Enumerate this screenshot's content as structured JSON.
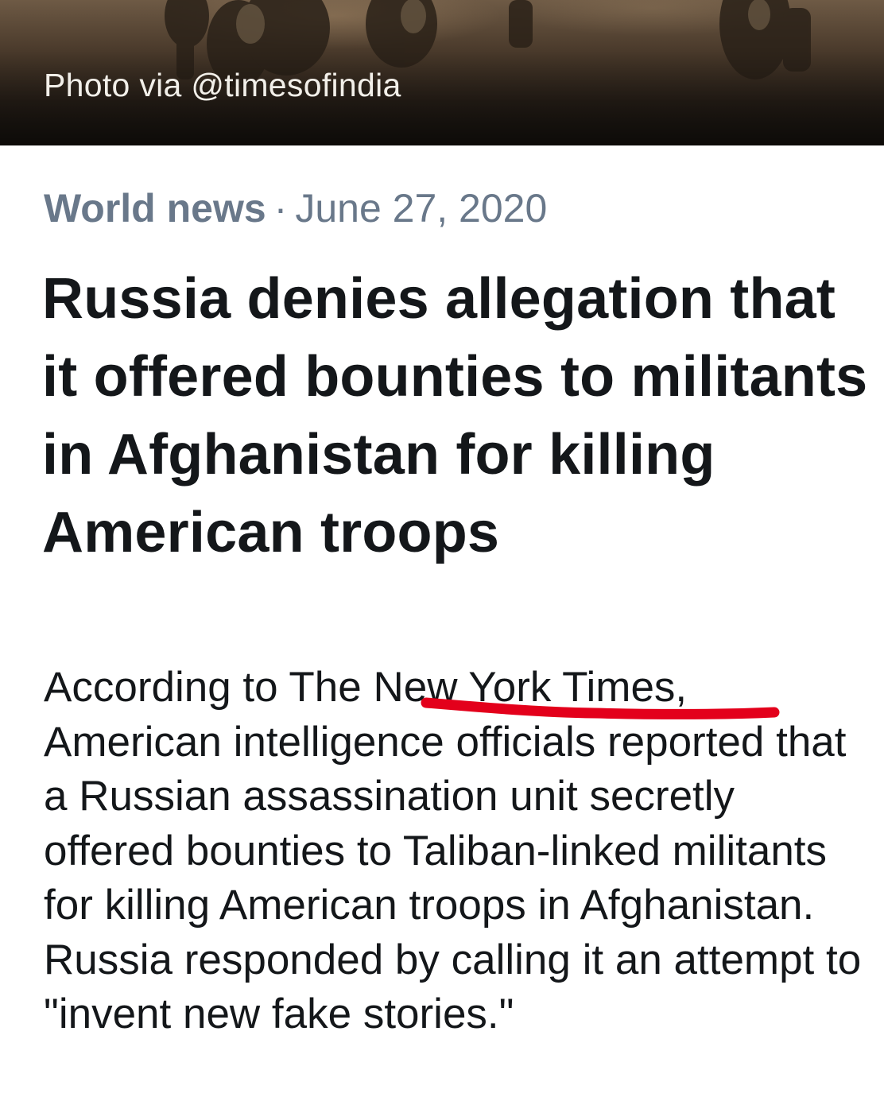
{
  "photo": {
    "credit": "Photo via @timesofindia"
  },
  "article": {
    "category": "World news",
    "separator": "·",
    "date": "June 27, 2020",
    "headline": "Russia denies allegation that it offered bounties to militants in Afghanistan for killing American troops",
    "summary_before": "According to The ",
    "summary_highlight": "New York Times",
    "summary_after": ", American intelligence officials reported that a Russian assassination unit secretly offered bounties to Taliban-linked militants for killing American troops in Afghanistan. Russia responded by calling it an attempt to \"invent new fake stories.\""
  },
  "colors": {
    "meta_text": "#69788a",
    "body_text": "#14171a",
    "annotation_red": "#e3001b"
  }
}
